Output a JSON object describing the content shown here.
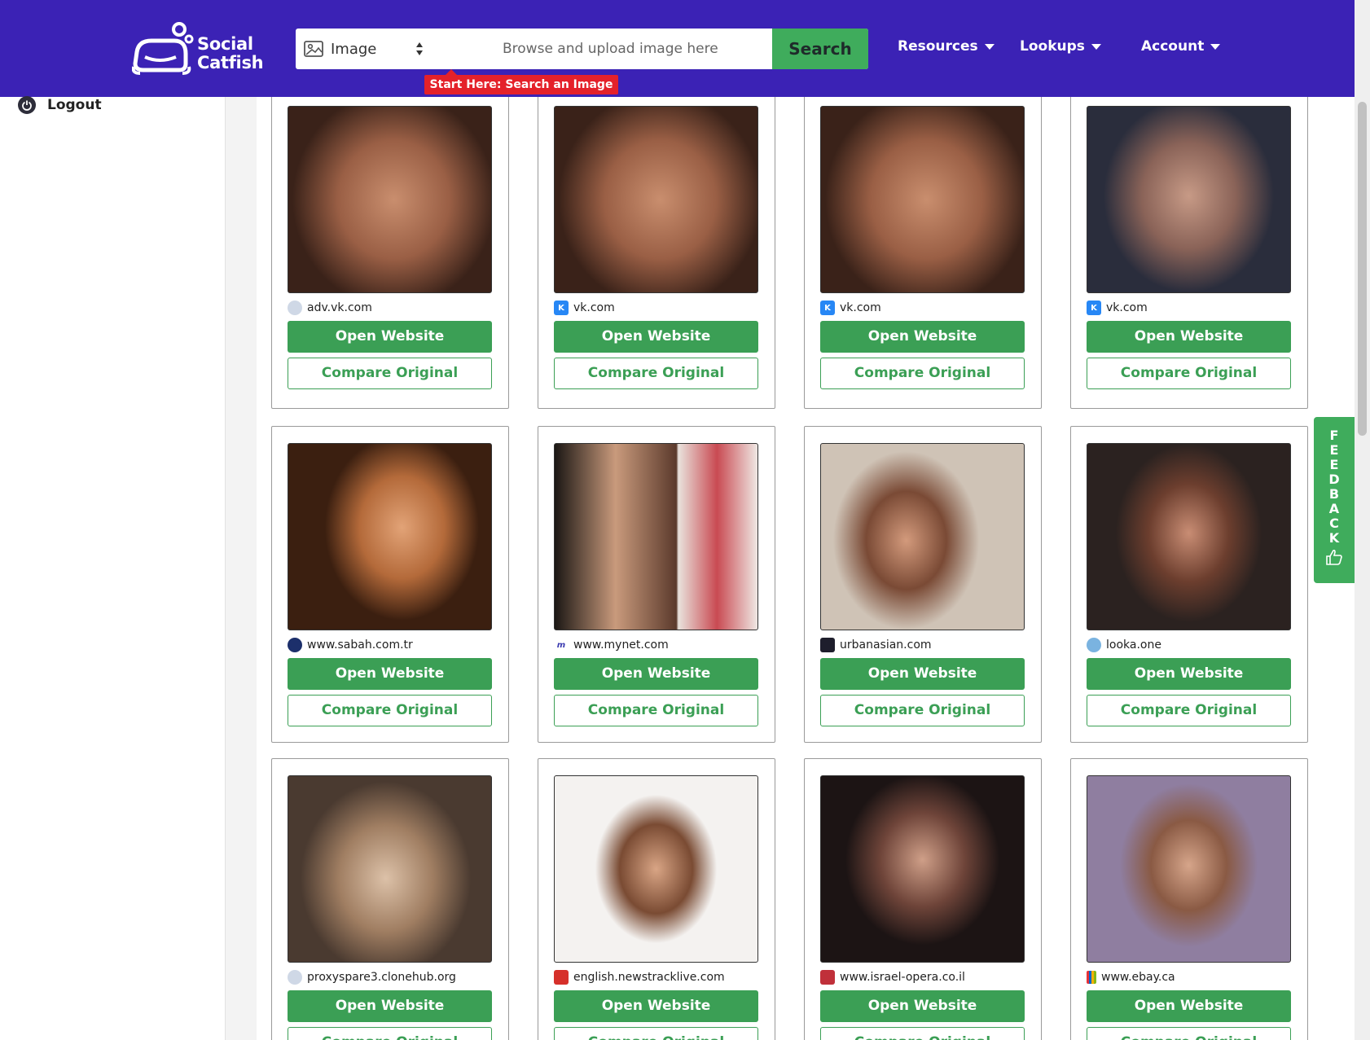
{
  "header": {
    "logo_line1": "Social",
    "logo_line2": "Catfish",
    "search_type": "Image",
    "search_placeholder": "Browse and upload image here",
    "search_button": "Search",
    "start_here": "Start Here: Search an Image",
    "nav": [
      "Resources",
      "Lookups",
      "Account"
    ]
  },
  "sidebar": {
    "logout": "Logout"
  },
  "feedback": {
    "letters": [
      "F",
      "E",
      "E",
      "D",
      "B",
      "A",
      "C",
      "K"
    ]
  },
  "results": [
    {
      "site": "adv.vk.com",
      "open": "Open Website",
      "compare": "Compare Original",
      "favicon": "globe-icon"
    },
    {
      "site": "vk.com",
      "open": "Open Website",
      "compare": "Compare Original",
      "favicon": "vk-icon"
    },
    {
      "site": "vk.com",
      "open": "Open Website",
      "compare": "Compare Original",
      "favicon": "vk-icon"
    },
    {
      "site": "vk.com",
      "open": "Open Website",
      "compare": "Compare Original",
      "favicon": "vk-icon"
    },
    {
      "site": "www.sabah.com.tr",
      "open": "Open Website",
      "compare": "Compare Original",
      "favicon": "sabah-icon"
    },
    {
      "site": "www.mynet.com",
      "open": "Open Website",
      "compare": "Compare Original",
      "favicon": "mynet-icon"
    },
    {
      "site": "urbanasian.com",
      "open": "Open Website",
      "compare": "Compare Original",
      "favicon": "urbanasian-icon"
    },
    {
      "site": "looka.one",
      "open": "Open Website",
      "compare": "Compare Original",
      "favicon": "looka-icon"
    },
    {
      "site": "proxyspare3.clonehub.org",
      "open": "Open Website",
      "compare": "Compare Original",
      "favicon": "globe-icon"
    },
    {
      "site": "english.newstracklive.com",
      "open": "Open Website",
      "compare": "Compare Original",
      "favicon": "newstrack-icon"
    },
    {
      "site": "www.israel-opera.co.il",
      "open": "Open Website",
      "compare": "Compare Original",
      "favicon": "opera-icon"
    },
    {
      "site": "www.ebay.ca",
      "open": "Open Website",
      "compare": "Compare Original",
      "favicon": "ebay-icon"
    }
  ],
  "colors": {
    "header": "#3b22b5",
    "accent_green": "#3b9f55",
    "start_here_red": "#e4212a"
  }
}
